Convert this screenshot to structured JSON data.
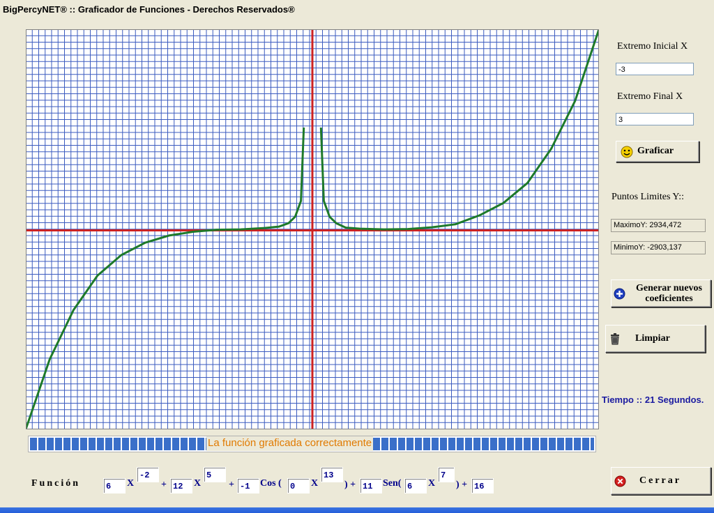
{
  "window": {
    "title": "BigPercyNET®  :: Graficador de Funciones - Derechos Reservados®"
  },
  "controls": {
    "x_start_label": "Extremo Inicial X",
    "x_start_value": "-3",
    "x_end_label": "Extremo Final X",
    "x_end_value": "3",
    "plot_button": "Graficar",
    "plot_icon": "smiley-icon",
    "limits_label": "Puntos Limites Y::",
    "max_y": "MaximoY: 2934,472",
    "min_y": "MinimoY: -2903,137",
    "generate_button_line1": "Generar nuevos",
    "generate_button_line2": "coeficientes",
    "generate_icon": "plus-circle-icon",
    "clear_button": "Limpiar",
    "clear_icon": "trash-icon",
    "time_text": "Tiempo :: 21 Segundos.",
    "close_button": "Cerrar",
    "close_icon": "close-circle-icon"
  },
  "progress": {
    "message": "La función graficada correctamente",
    "fraction": 1.0
  },
  "function": {
    "label": "Función",
    "c1": "6",
    "x1": "X",
    "e1": "-2",
    "plus1": "+",
    "c2": "12",
    "x2": "X",
    "e2": "5",
    "plus2": "+",
    "c3": "-1",
    "cos": "Cos (",
    "c4": "0",
    "x3": "X",
    "e3": "13",
    "close1": ") +",
    "c5": "11",
    "sen": "Sen(",
    "c6": "6",
    "x4": "X",
    "e4": "7",
    "close2": ") +",
    "c7": "16"
  },
  "colors": {
    "grid": "#3B5BBF",
    "axes": "#CC2222",
    "curve": "#1E7A2A",
    "accent": "#E07A00",
    "label_blue": "#1a1aa0"
  },
  "chart_data": {
    "type": "line",
    "function": "6x^-2 + 12x^5 - cos(0x^13) + 11 sen(6x^7) + 16",
    "xlim": [
      -3,
      3
    ],
    "ylim": [
      -2903.137,
      2934.472
    ],
    "series": [
      {
        "x": [
          -3,
          -2.75,
          -2.5,
          -2.25,
          -2,
          -1.75,
          -1.5,
          -1.25,
          -1,
          -0.75,
          -0.5,
          -0.35,
          -0.25,
          -0.18,
          -0.12,
          -0.09,
          0.09,
          0.12,
          0.18,
          0.25,
          0.35,
          0.5,
          0.75,
          1,
          1.25,
          1.5,
          1.75,
          2,
          2.25,
          2.5,
          2.75,
          3
        ],
        "y": [
          -2900,
          -1880,
          -1160,
          -660,
          -360,
          -180,
          -75,
          -20,
          10,
          15,
          35,
          55,
          105,
          200,
          430,
          1500,
          1500,
          430,
          200,
          105,
          40,
          25,
          15,
          20,
          45,
          90,
          220,
          400,
          690,
          1190,
          1890,
          2934
        ]
      }
    ]
  }
}
